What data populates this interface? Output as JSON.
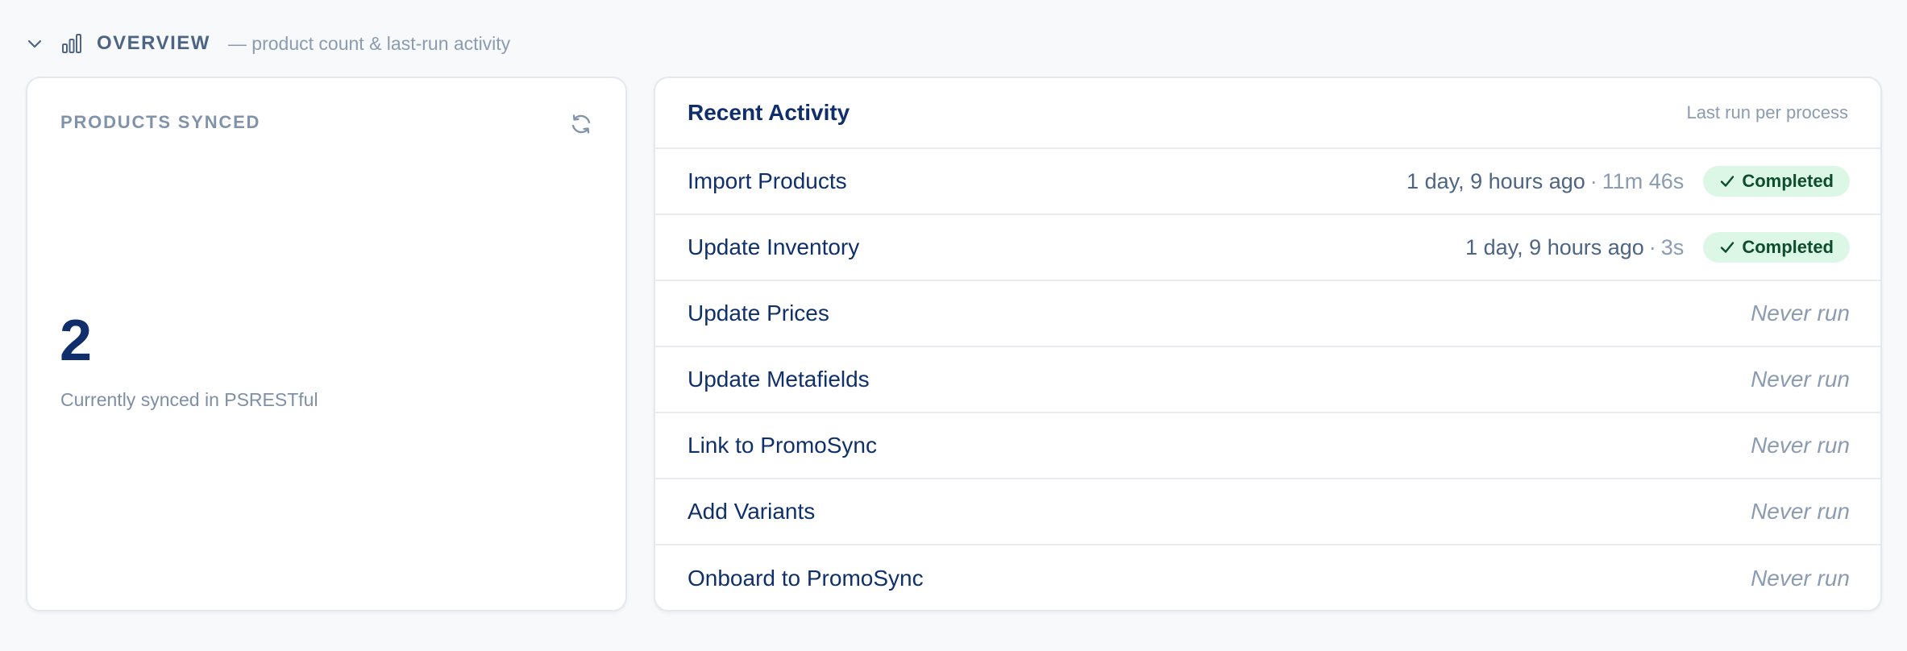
{
  "overview": {
    "title": "OVERVIEW",
    "subtitle": "— product count & last-run activity"
  },
  "products": {
    "label": "PRODUCTS SYNCED",
    "count": "2",
    "caption": "Currently synced in PSRESTful"
  },
  "activity": {
    "title": "Recent Activity",
    "hint": "Last run per process",
    "rows": [
      {
        "name": "Import Products",
        "time": "1 day, 9 hours ago",
        "sep": "·",
        "duration": "11m 46s",
        "status": "Completed"
      },
      {
        "name": "Update Inventory",
        "time": "1 day, 9 hours ago",
        "sep": "·",
        "duration": "3s",
        "status": "Completed"
      },
      {
        "name": "Update Prices",
        "never": "Never run"
      },
      {
        "name": "Update Metafields",
        "never": "Never run"
      },
      {
        "name": "Link to PromoSync",
        "never": "Never run"
      },
      {
        "name": "Add Variants",
        "never": "Never run"
      },
      {
        "name": "Onboard to PromoSync",
        "never": "Never run"
      }
    ]
  },
  "icons": {
    "collapse": "chevron-down-icon",
    "section": "bar-chart-icon",
    "refresh": "refresh-icon",
    "status": "check-icon"
  },
  "colors": {
    "accent": "#10306b",
    "muted": "#8b9bb1",
    "success_bg": "#dcf7e6",
    "success_text": "#0d4d2c"
  }
}
